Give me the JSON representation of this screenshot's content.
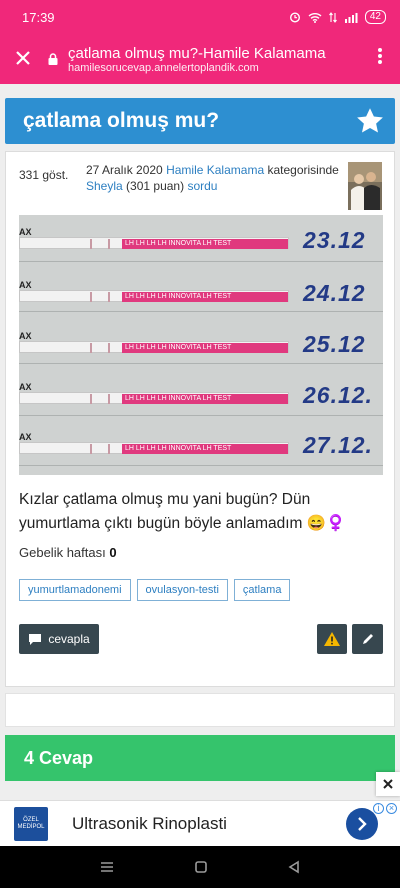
{
  "status_bar": {
    "time": "17:39",
    "battery": "42"
  },
  "browser": {
    "page_title": "çatlama olmuş mu?-Hamile Kalamama",
    "domain": "hamilesorucevap.annelertoplandik.com"
  },
  "question": {
    "title": "çatlama olmuş mu?",
    "views": "331 göst.",
    "date": "27 Aralık 2020",
    "category": "Hamile Kalamama",
    "category_suffix": "kategorisinde",
    "author": "Sheyla",
    "points": "(301 puan)",
    "action": "sordu",
    "body": "Kızlar çatlama olmuş mu yani bugün? Dün yumurtlama çıktı bugün böyle anlamadım 😄♀️",
    "week_label": "Gebelik haftası",
    "week_value": "0",
    "tags": [
      "yumurtlamadonemi",
      "ovulasyon-testi",
      "çatlama"
    ],
    "reply_label": "cevapla"
  },
  "photo": {
    "strip_label": "LH LH LH LH INNOVITA LH TEST",
    "ax": "AX",
    "dates": [
      "23.12",
      "24.12",
      "25.12",
      "26.12.",
      "27.12."
    ]
  },
  "answers": {
    "title": "4 Cevap"
  },
  "ad": {
    "logo_text": "ÖZEL MEDİPOL",
    "text": "Ultrasonik Rinoplasti"
  },
  "colors": {
    "brand_pink": "#f0287a",
    "title_blue": "#2d8fd1",
    "answers_green": "#35c46c",
    "button_dark": "#37474f"
  }
}
